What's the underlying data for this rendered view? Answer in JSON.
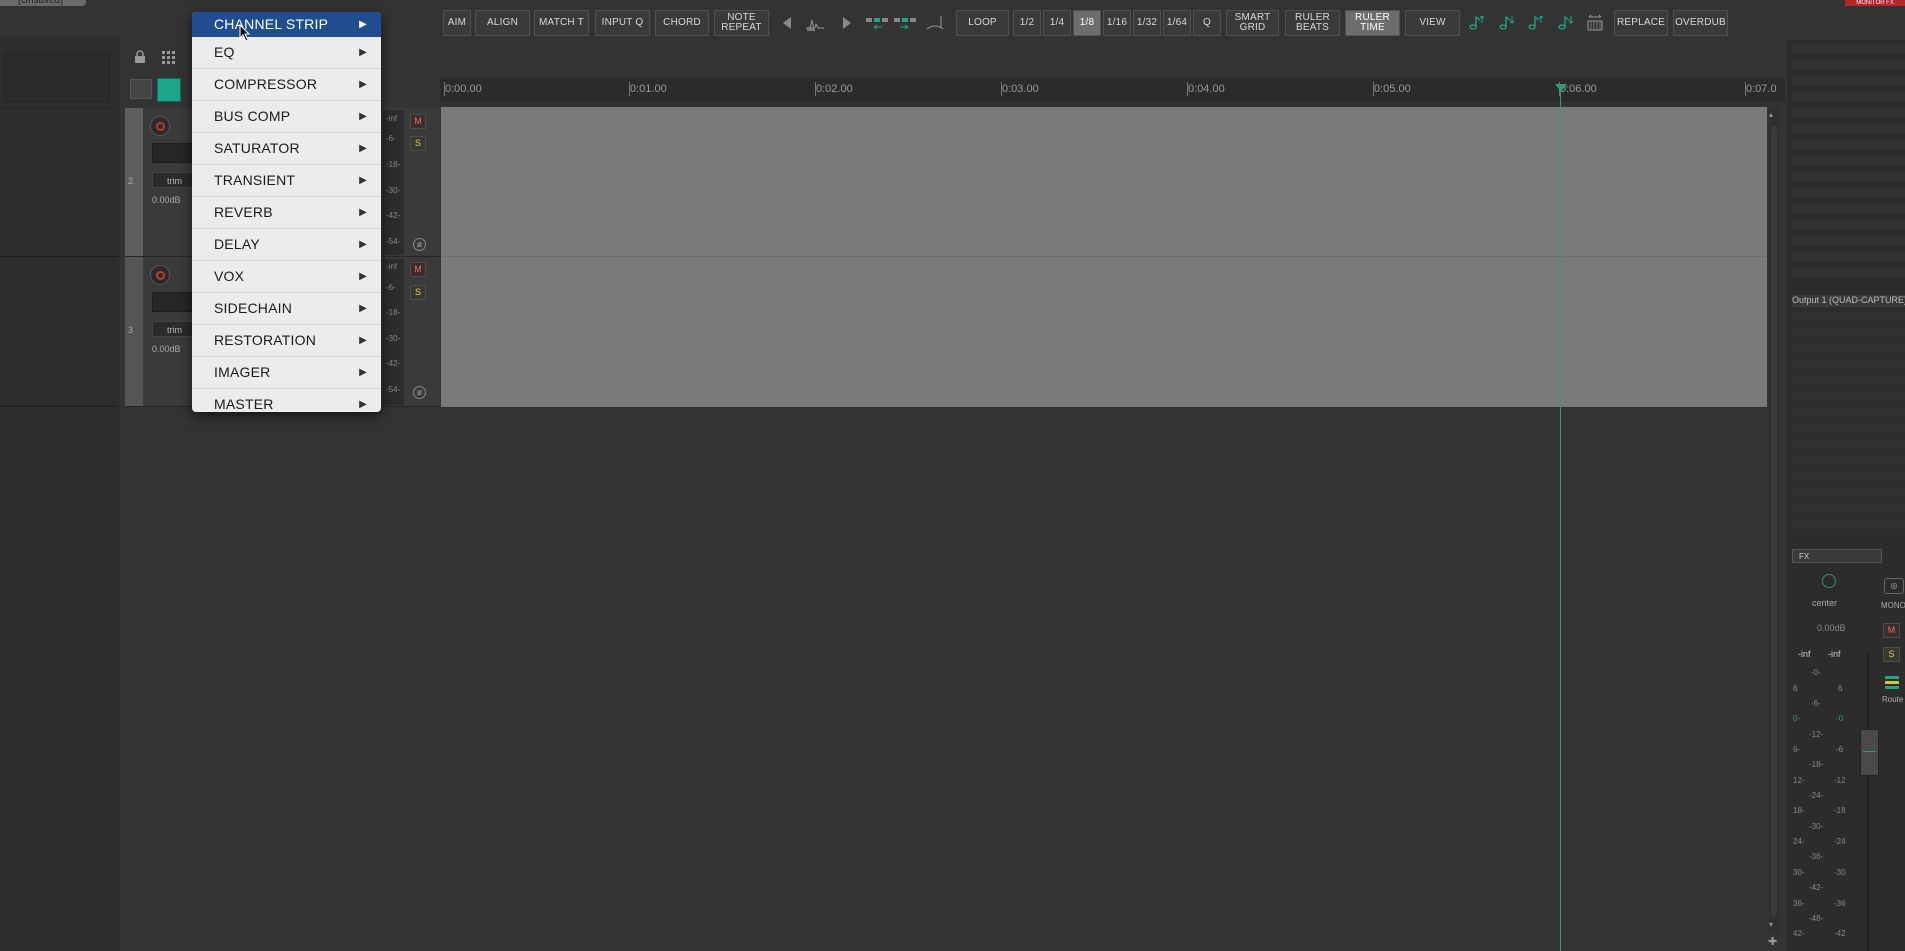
{
  "window": {
    "title_tab": "[Unsaved]",
    "monitor_tag": "MONITOR FX"
  },
  "toolbar": {
    "buttons": [
      {
        "label": "AIM"
      },
      {
        "label": "ALIGN"
      },
      {
        "label": "MATCH T"
      },
      {
        "label": "INPUT Q"
      },
      {
        "label": "CHORD"
      },
      {
        "label": "NOTE",
        "label2": "REPEAT"
      },
      {
        "label": "LOOP"
      },
      {
        "label": "1/2"
      },
      {
        "label": "1/4"
      },
      {
        "label": "1/8",
        "active": true
      },
      {
        "label": "1/16"
      },
      {
        "label": "1/32"
      },
      {
        "label": "1/64"
      },
      {
        "label": "Q"
      },
      {
        "label": "SMART",
        "label2": "GRID"
      },
      {
        "label": "RULER",
        "label2": "BEATS"
      },
      {
        "label": "RULER",
        "label2": "TIME",
        "active": true
      },
      {
        "label": "VIEW"
      },
      {
        "label": "REPLACE"
      },
      {
        "label": "OVERDUB"
      }
    ],
    "icons": [
      "nudge-left-icon",
      "waveform-icon",
      "nudge-right-icon",
      "move-left-icon",
      "move-right-icon",
      "note-tie-icon",
      "note-up-icon",
      "note-down-icon",
      "note-up-8va-icon",
      "note-down-8va-icon",
      "grid-fit-icon"
    ]
  },
  "ruler": {
    "labels": [
      "0:00.00",
      "0:01.00",
      "0:02.00",
      "0:03.00",
      "0:04.00",
      "0:05.00",
      "0:06.00",
      "0:07.0"
    ]
  },
  "tracks": [
    {
      "number": "2",
      "trim": "trim",
      "volume": "0.00dB",
      "mute": "M",
      "solo": "S",
      "meter_labels": [
        "-inf",
        "-6-",
        "-18-",
        "-30-",
        "-42-",
        "-54-"
      ]
    },
    {
      "number": "3",
      "trim": "trim",
      "volume": "0.00dB",
      "mute": "M",
      "solo": "S",
      "meter_labels": [
        "-inf",
        "-6-",
        "-18-",
        "-30-",
        "-42-",
        "-54-"
      ]
    }
  ],
  "context_menu": {
    "items": [
      {
        "label": "CHANNEL STRIP",
        "selected": true
      },
      {
        "label": "EQ"
      },
      {
        "label": "COMPRESSOR"
      },
      {
        "label": "BUS COMP"
      },
      {
        "label": "SATURATOR"
      },
      {
        "label": "TRANSIENT"
      },
      {
        "label": "REVERB"
      },
      {
        "label": "DELAY"
      },
      {
        "label": "VOX"
      },
      {
        "label": "SIDECHAIN"
      },
      {
        "label": "RESTORATION"
      },
      {
        "label": "IMAGER"
      },
      {
        "label": "MASTER"
      }
    ],
    "submenu_arrow": "▶"
  },
  "mixer": {
    "output": "Output 1 (QUAD-CAPTURE)",
    "fx": "FX",
    "pan": "center",
    "mono": "MONO",
    "volume": "0.00dB",
    "peak_left": "-inf",
    "peak_right": "-inf",
    "mute": "M",
    "solo": "S",
    "route": "Route",
    "scale_center": [
      "-0-",
      "-6-",
      "-12-",
      "-18-",
      "-24-",
      "-30-",
      "-36-",
      "-42-",
      "-48-"
    ],
    "scale_left": [
      "6",
      "0-",
      "6-",
      "12-",
      "18-",
      "24-",
      "30-",
      "36-",
      "42-"
    ],
    "scale_right": [
      "6",
      "-0",
      "-6",
      "-12",
      "-18",
      "-24",
      "-30",
      "-36",
      "-42"
    ]
  },
  "colors": {
    "menu_highlight": "#1f4d8f",
    "cursor": "#2f9a80",
    "lane": "#7a7a7a"
  }
}
